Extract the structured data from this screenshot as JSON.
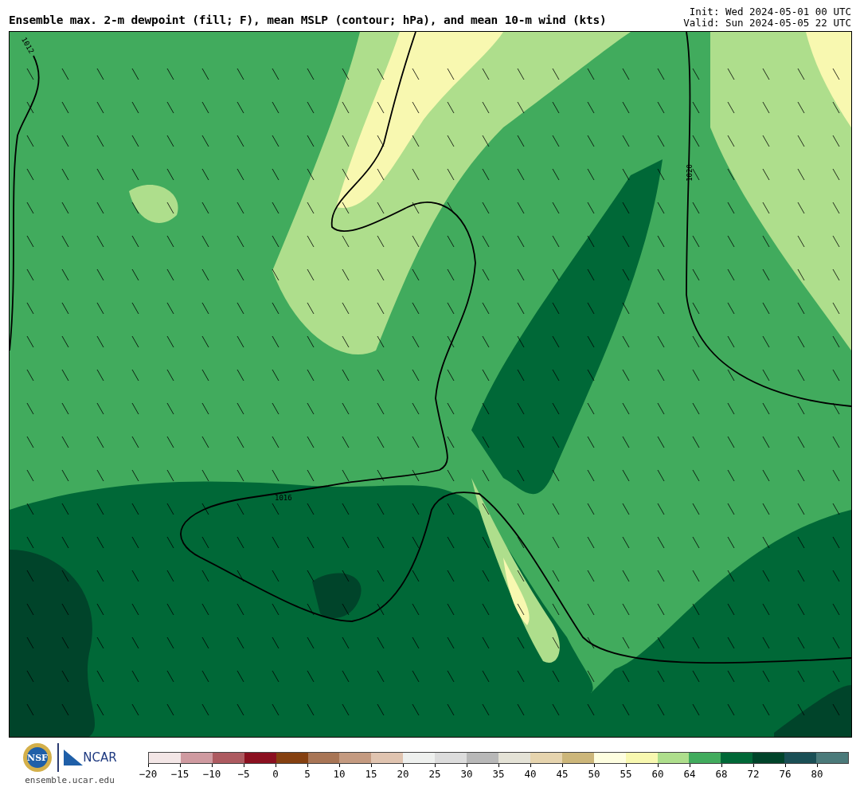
{
  "header": {
    "title": "Ensemble max. 2-m dewpoint (fill; F), mean MSLP (contour; hPa), and mean 10-m wind (kts)",
    "init": "Init: Wed 2024-05-01 00 UTC",
    "valid": "Valid: Sun 2024-05-05 22 UTC"
  },
  "map": {
    "contour_labels": [
      "1012",
      "1020",
      "1016"
    ]
  },
  "logos": {
    "nsf": "NSF",
    "ncar": "NCAR",
    "site": "ensemble.ucar.edu"
  },
  "colorbar": [
    {
      "label": "−20",
      "color": "#f3e6e6"
    },
    {
      "label": "−15",
      "color": "#cf9aa0"
    },
    {
      "label": "−10",
      "color": "#ad5a60"
    },
    {
      "label": "−5",
      "color": "#8b1020"
    },
    {
      "label": "0",
      "color": "#854010"
    },
    {
      "label": "5",
      "color": "#a87555"
    },
    {
      "label": "10",
      "color": "#c49a80"
    },
    {
      "label": "15",
      "color": "#e0c4b0"
    },
    {
      "label": "20",
      "color": "#eef0ee"
    },
    {
      "label": "25",
      "color": "#dcdcdc"
    },
    {
      "label": "30",
      "color": "#b8b8b8"
    },
    {
      "label": "35",
      "color": "#e4e2d6"
    },
    {
      "label": "40",
      "color": "#e6d4ae"
    },
    {
      "label": "45",
      "color": "#ccb67a"
    },
    {
      "label": "50",
      "color": "#fefee0"
    },
    {
      "label": "55",
      "color": "#f8f8b0"
    },
    {
      "label": "60",
      "color": "#aede8c"
    },
    {
      "label": "64",
      "color": "#41ab5d"
    },
    {
      "label": "68",
      "color": "#006837"
    },
    {
      "label": "72",
      "color": "#00442a"
    },
    {
      "label": "76",
      "color": "#1a4f55"
    },
    {
      "label": "80",
      "color": "#4b7a7a"
    }
  ]
}
